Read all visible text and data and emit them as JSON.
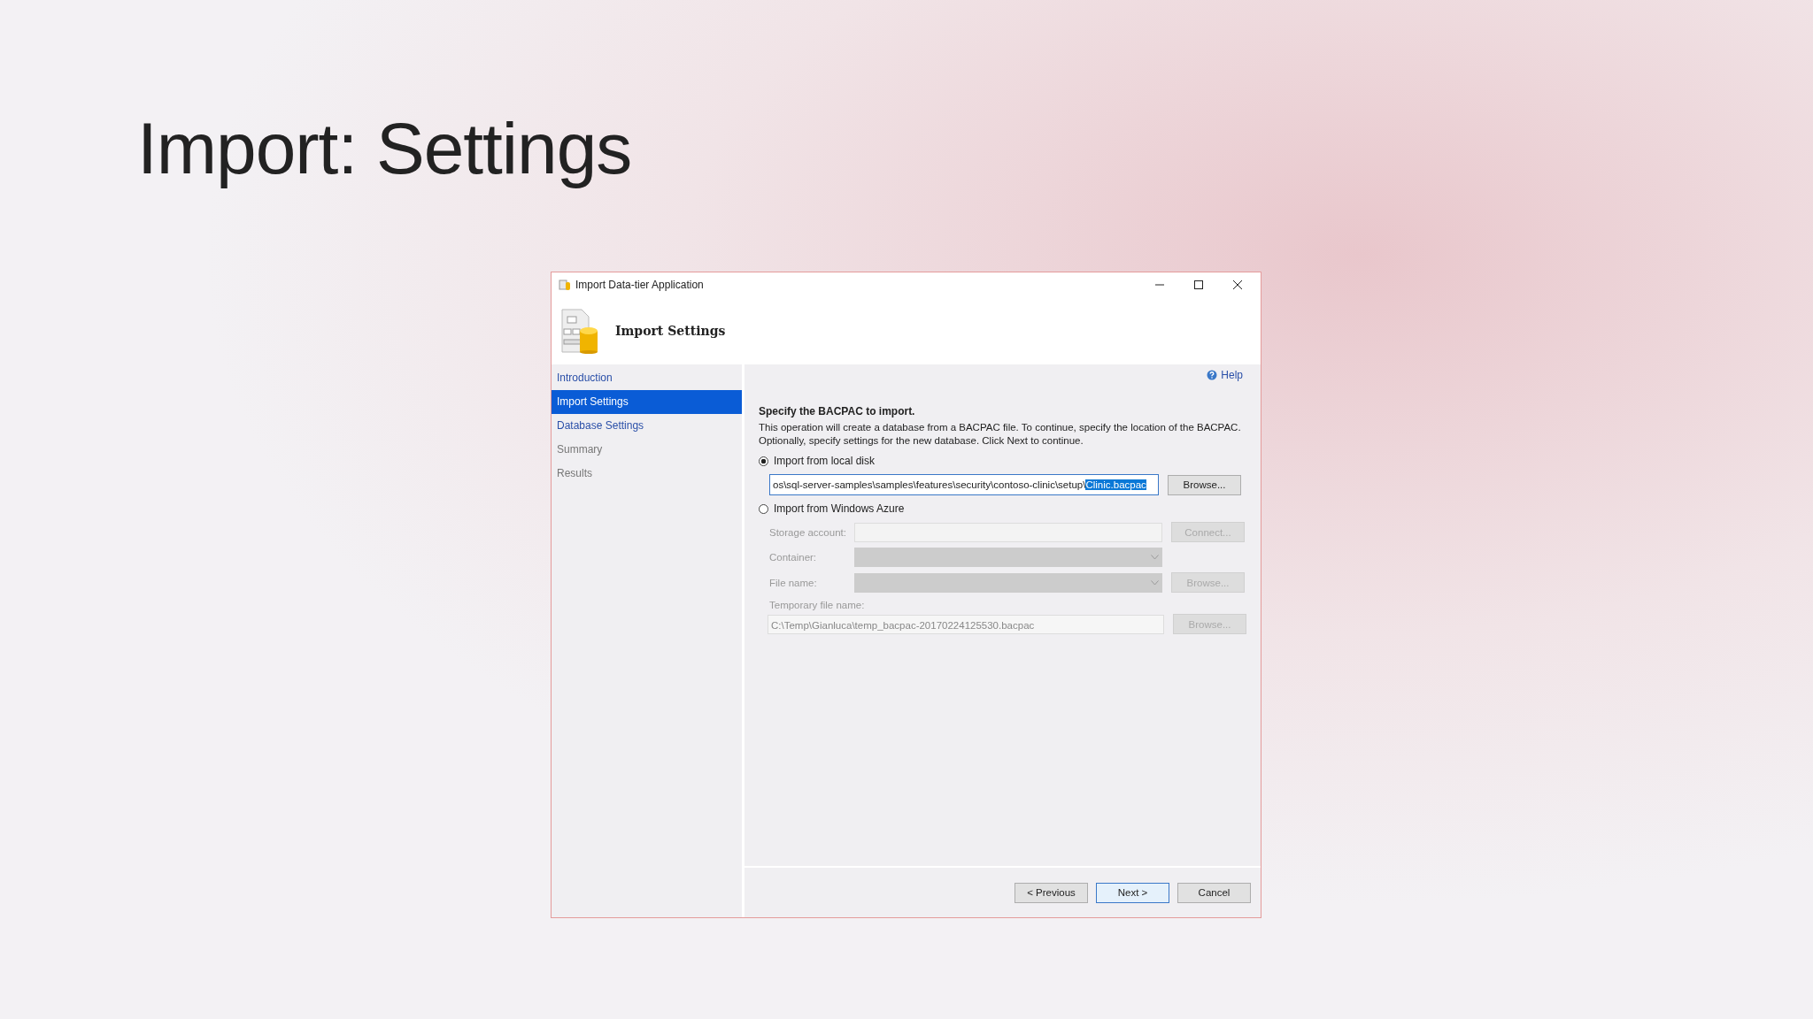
{
  "slide": {
    "title": "Import: Settings"
  },
  "window": {
    "title": "Import Data-tier Application",
    "header": "Import Settings"
  },
  "nav": [
    {
      "label": "Introduction",
      "selected": false,
      "disabled": false
    },
    {
      "label": "Import Settings",
      "selected": true,
      "disabled": false
    },
    {
      "label": "Database Settings",
      "selected": false,
      "disabled": false
    },
    {
      "label": "Summary",
      "selected": false,
      "disabled": true
    },
    {
      "label": "Results",
      "selected": false,
      "disabled": true
    }
  ],
  "help": "Help",
  "heading": "Specify the BACPAC to import.",
  "description": "This operation will create a database from a BACPAC file. To continue, specify the location of the BACPAC. Optionally, specify settings for the new database. Click Next to continue.",
  "local": {
    "label": "Import from local disk",
    "selected": true,
    "path_value": "os\\sql-server-samples\\samples\\features\\security\\contoso-clinic\\setup\\",
    "path_selection": "Clinic.bacpac",
    "browse": "Browse..."
  },
  "azure": {
    "label": "Import from Windows Azure",
    "selected": false,
    "disabled": true,
    "rows": [
      {
        "kind": "input",
        "label": "Storage account:",
        "button": "Connect..."
      },
      {
        "kind": "dropdown",
        "label": "Container:"
      },
      {
        "kind": "dropdown",
        "label": "File name:",
        "button": "Browse..."
      }
    ],
    "temp_label": "Temporary file name:",
    "temp_value": "C:\\Temp\\Gianluca\\temp_bacpac-20170224125530.bacpac",
    "temp_button": "Browse..."
  },
  "buttons": [
    {
      "label": "< Previous",
      "default": false
    },
    {
      "label": "Next >",
      "default": true
    },
    {
      "label": "Cancel",
      "default": false
    }
  ]
}
